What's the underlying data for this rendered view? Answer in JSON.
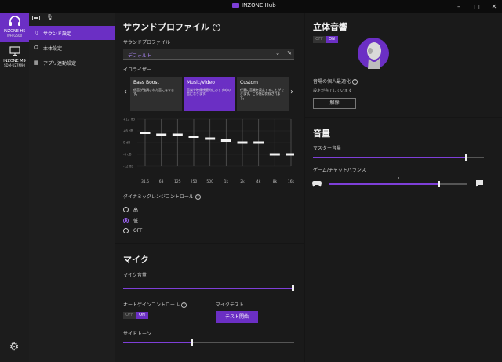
{
  "window": {
    "title": "INZONE Hub",
    "controls": {
      "minimize": "–",
      "maximize": "□",
      "close": "✕"
    }
  },
  "devices": [
    {
      "name": "INZONE H5",
      "model": "WH-G500",
      "icon": "headphones-icon",
      "active": true
    },
    {
      "name": "INZONE M9",
      "model": "SDM-U27M90",
      "icon": "monitor-icon",
      "active": false
    }
  ],
  "nav": {
    "top_icons": [
      "battery-icon",
      "microphone-icon"
    ],
    "items": [
      {
        "label": "サウンド設定",
        "icon": "music-note-icon",
        "active": true
      },
      {
        "label": "本体設定",
        "icon": "headset-icon",
        "active": false
      },
      {
        "label": "アプリ連動設定",
        "icon": "grid-icon",
        "active": false
      }
    ]
  },
  "sound_profile": {
    "title": "サウンドプロファイル",
    "profile_label": "サウンドプロファイル",
    "profile_value": "デフォルト",
    "eq_label": "イコライザー",
    "presets": [
      {
        "title": "Bass Boost",
        "desc": "低音が強調された音になります。",
        "active": false
      },
      {
        "title": "Music/Video",
        "desc": "音楽や映像視聴時におすすめの音になります。",
        "active": true
      },
      {
        "title": "Custom",
        "desc": "任意に音質を設定することができます。この値は保存されます。",
        "active": false
      }
    ],
    "eq_scale": [
      "+12 dB",
      "+6 dB",
      "0 dB",
      "-6 dB",
      "-12 dB"
    ],
    "eq_bands": [
      "31.5",
      "63",
      "125",
      "250",
      "500",
      "1k",
      "2k",
      "4k",
      "8k",
      "16k"
    ],
    "eq_values_db": [
      5,
      4,
      4,
      3,
      2,
      1,
      0,
      0,
      -6,
      -6
    ],
    "eq_range_db": [
      -12,
      12
    ],
    "drc_label": "ダイナミックレンジコントロール",
    "drc_options": [
      {
        "label": "高",
        "selected": false
      },
      {
        "label": "低",
        "selected": true
      },
      {
        "label": "OFF",
        "selected": false
      }
    ]
  },
  "mic": {
    "title": "マイク",
    "volume_label": "マイク音量",
    "volume_level": 1.0,
    "agc_label": "オートゲインコントロール",
    "agc_off": "OFF",
    "agc_on": "ON",
    "test_label": "マイクテスト",
    "test_button": "テスト開始",
    "sidetone_label": "サイドトーン",
    "sidetone_level": 0.4
  },
  "spatial": {
    "title": "立体音響",
    "toggle_off": "OFF",
    "toggle_on": "ON",
    "personal_label": "音場の個人最適化",
    "status": "設定が完了しています",
    "clear_button": "解除"
  },
  "volume": {
    "title": "音量",
    "master_label": "マスター音量",
    "master_level": 0.9,
    "balance_label": "ゲーム/チャットバランス",
    "balance_level": 0.8
  },
  "colors": {
    "accent": "#6b2fc4",
    "background": "#151515"
  }
}
